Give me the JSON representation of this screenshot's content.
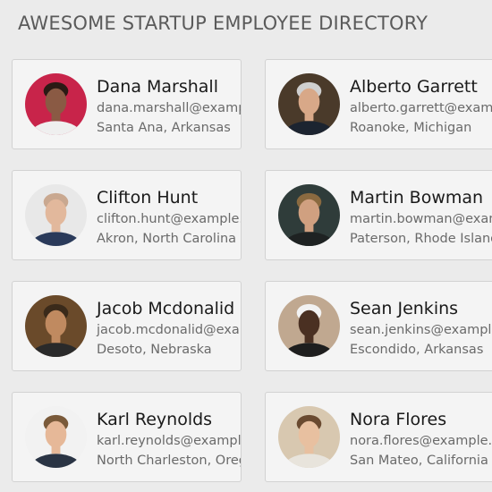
{
  "header": {
    "title": "AWESOME STARTUP EMPLOYEE DIRECTORY"
  },
  "employees": [
    {
      "name": "Dana Marshall",
      "email": "dana.marshall@example.com",
      "location": "Santa Ana, Arkansas",
      "avatar_bg": "#c8244a",
      "avatar_skin": "#8a5a44",
      "avatar_hair": "#2a1a14",
      "avatar_shirt": "#efefef"
    },
    {
      "name": "Alberto Garrett",
      "email": "alberto.garrett@example.com",
      "location": "Roanoke, Michigan",
      "avatar_bg": "#4a3a2a",
      "avatar_skin": "#d8a888",
      "avatar_hair": "#cfcfcf",
      "avatar_shirt": "#1c2430"
    },
    {
      "name": "Clifton Hunt",
      "email": "clifton.hunt@example.com",
      "location": "Akron, North Carolina",
      "avatar_bg": "#e8e8e8",
      "avatar_skin": "#e2b89c",
      "avatar_hair": "#c9a890",
      "avatar_shirt": "#2a3a5a"
    },
    {
      "name": "Martin Bowman",
      "email": "martin.bowman@example.com",
      "location": "Paterson, Rhode Island",
      "avatar_bg": "#2f3c3a",
      "avatar_skin": "#d0a080",
      "avatar_hair": "#8a6a40",
      "avatar_shirt": "#1e2222"
    },
    {
      "name": "Jacob Mcdonalid",
      "email": "jacob.mcdonalid@example.com",
      "location": "Desoto, Nebraska",
      "avatar_bg": "#6a4a2a",
      "avatar_skin": "#c08a60",
      "avatar_hair": "#3a2a1a",
      "avatar_shirt": "#2a2a2a"
    },
    {
      "name": "Sean Jenkins",
      "email": "sean.jenkins@example.com",
      "location": "Escondido, Arkansas",
      "avatar_bg": "#c0a890",
      "avatar_skin": "#4a3022",
      "avatar_hair": "#f2f2f2",
      "avatar_shirt": "#1e1e1e"
    },
    {
      "name": "Karl Reynolds",
      "email": "karl.reynolds@example.com",
      "location": "North Charleston, Oregon",
      "avatar_bg": "#f2f2f2",
      "avatar_skin": "#e6b898",
      "avatar_hair": "#7a5a3a",
      "avatar_shirt": "#2a3444"
    },
    {
      "name": "Nora Flores",
      "email": "nora.flores@example.com",
      "location": "San Mateo, California",
      "avatar_bg": "#d8c8b0",
      "avatar_skin": "#e8c0a0",
      "avatar_hair": "#6a4a30",
      "avatar_shirt": "#e8e4dc"
    }
  ]
}
